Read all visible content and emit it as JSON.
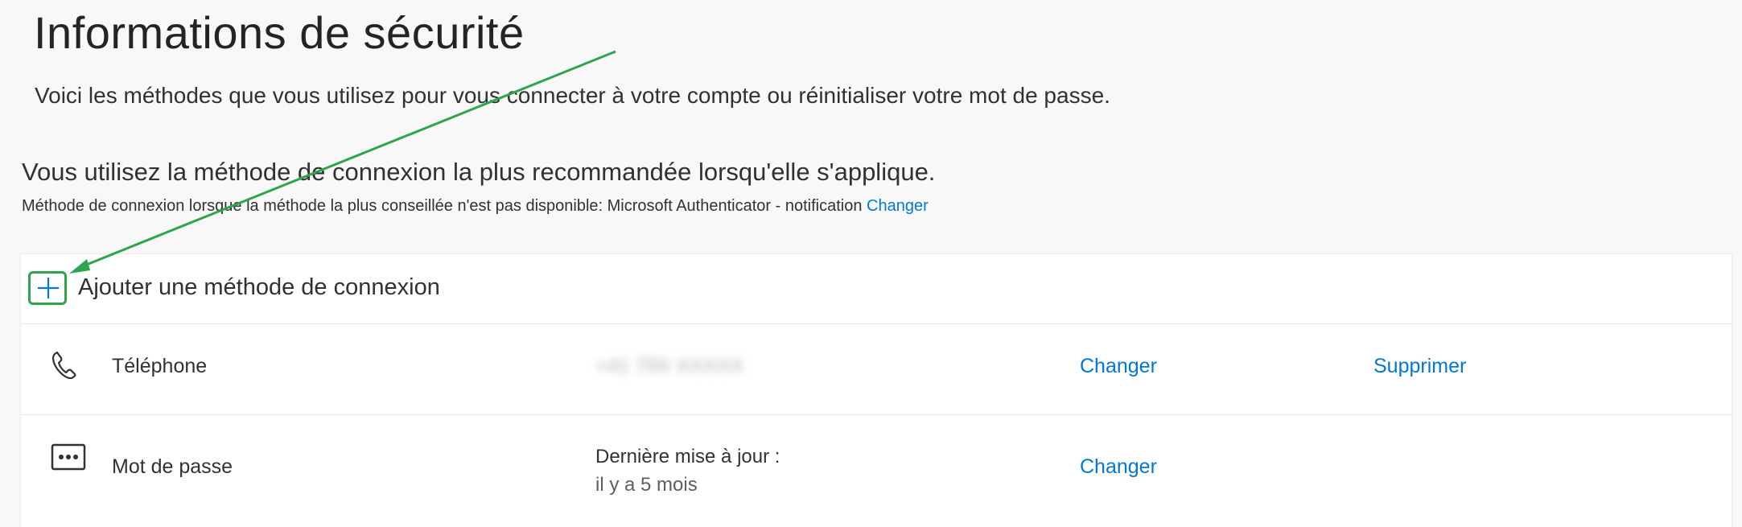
{
  "page": {
    "title": "Informations de sécurité",
    "subtitle": "Voici les méthodes que vous utilisez pour vous connecter à votre compte ou réinitialiser votre mot de passe."
  },
  "default_method": {
    "headline": "Vous utilisez la méthode de connexion la plus recommandée lorsqu'elle s'applique.",
    "detail": "Méthode de connexion lorsque la méthode la plus conseillée n'est pas disponible: Microsoft Authenticator - notification",
    "change_link": "Changer"
  },
  "add_method": {
    "label": "Ajouter une méthode de connexion",
    "icon": "plus-icon"
  },
  "methods": [
    {
      "icon": "phone-icon",
      "label": "Téléphone",
      "value": "+41 79X XXXXX",
      "change": "Changer",
      "delete": "Supprimer"
    },
    {
      "icon": "password-icon",
      "label": "Mot de passe",
      "info_line1": "Dernière mise à jour :",
      "info_line2": "il y a 5 mois",
      "change": "Changer"
    }
  ],
  "colors": {
    "link": "#0078d4",
    "annotation": "#2ea44f",
    "background": "#f8f8f8"
  }
}
